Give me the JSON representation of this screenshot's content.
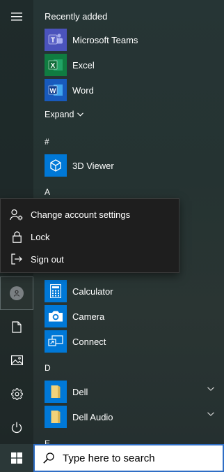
{
  "recently_added": {
    "header": "Recently added",
    "apps": [
      {
        "label": "Microsoft Teams"
      },
      {
        "label": "Excel"
      },
      {
        "label": "Word"
      }
    ],
    "expand_label": "Expand"
  },
  "letters": {
    "hash": "#",
    "a": "A",
    "d": "D",
    "e": "E"
  },
  "apps": {
    "viewer3d": "3D Viewer",
    "calculator": "Calculator",
    "camera": "Camera",
    "connect": "Connect",
    "dell": "Dell",
    "dell_audio": "Dell Audio"
  },
  "account_menu": {
    "change_settings": "Change account settings",
    "lock": "Lock",
    "sign_out": "Sign out"
  },
  "taskbar": {
    "search_placeholder": "Type here to search"
  },
  "colors": {
    "accent": "#0078d7",
    "teams": "#4b53bc",
    "excel": "#107c41",
    "word": "#185abd",
    "search_border": "#2f6ec5"
  }
}
